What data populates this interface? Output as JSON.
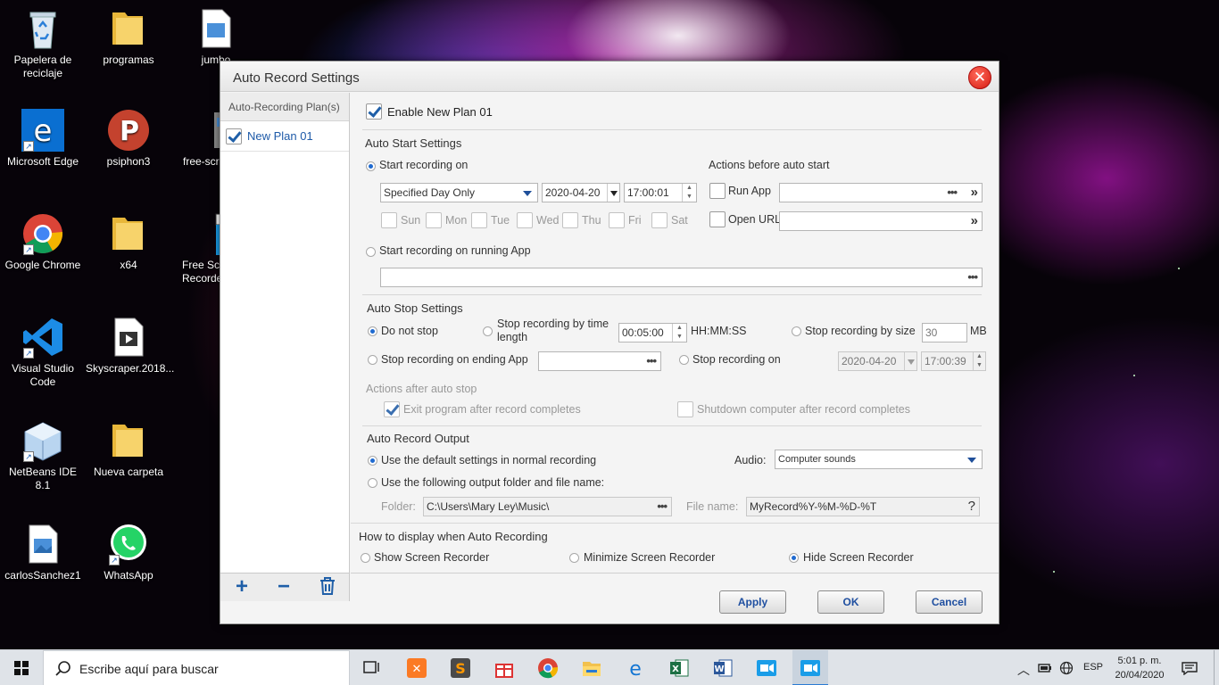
{
  "desktop": {
    "icons": [
      {
        "label": "Papelera de reciclaje",
        "icon": "recycle-bin-icon"
      },
      {
        "label": "programas",
        "icon": "folder-icon"
      },
      {
        "label": "jumbo",
        "icon": "image-file-icon"
      },
      {
        "label": "Microsoft Edge",
        "icon": "edge-icon"
      },
      {
        "label": "psiphon3",
        "icon": "psiphon-icon"
      },
      {
        "label": "free-scree",
        "icon": "app-icon"
      },
      {
        "label": "Google Chrome",
        "icon": "chrome-icon"
      },
      {
        "label": "x64",
        "icon": "folder-icon"
      },
      {
        "label": "Free Sc Recorde",
        "icon": "screen-recorder-icon"
      },
      {
        "label": "Visual Studio Code",
        "icon": "vscode-icon"
      },
      {
        "label": "Skyscraper.2018...",
        "icon": "video-file-icon"
      },
      {
        "label": "NetBeans IDE 8.1",
        "icon": "netbeans-icon"
      },
      {
        "label": "Nueva carpeta",
        "icon": "folder-icon"
      },
      {
        "label": "carlosSanchez1",
        "icon": "image-file-icon"
      },
      {
        "label": "WhatsApp",
        "icon": "whatsapp-icon"
      }
    ]
  },
  "dialog": {
    "title": "Auto Record Settings",
    "plan_list_header": "Auto-Recording Plan(s)",
    "plans": [
      {
        "name": "New Plan 01",
        "checked": true
      }
    ],
    "enable_label": "Enable New Plan 01",
    "auto_start": {
      "heading": "Auto Start Settings",
      "start_on_label": "Start recording on",
      "schedule_mode": "Specified Day Only",
      "date": "2020-04-20",
      "time": "17:00:01",
      "days": [
        "Sun",
        "Mon",
        "Tue",
        "Wed",
        "Thu",
        "Fri",
        "Sat"
      ],
      "running_app_label": "Start recording on running App",
      "actions_heading": "Actions before auto start",
      "run_app_label": "Run App",
      "open_url_label": "Open URL"
    },
    "auto_stop": {
      "heading": "Auto Stop Settings",
      "do_not_stop": "Do not stop",
      "by_time_label": "Stop recording by time length",
      "time_length": "00:05:00",
      "time_unit": "HH:MM:SS",
      "by_size_label": "Stop recording by size",
      "size_value": "30",
      "size_unit": "MB",
      "ending_app_label": "Stop recording on ending App",
      "stop_on_label": "Stop recording on",
      "stop_date": "2020-04-20",
      "stop_time": "17:00:39",
      "actions_after": "Actions after auto stop",
      "exit_program": "Exit program after record completes",
      "shutdown": "Shutdown computer after record completes"
    },
    "output": {
      "heading": "Auto Record Output",
      "default_settings": "Use the default settings in normal recording",
      "custom_output": "Use the following output folder and file name:",
      "audio_label": "Audio:",
      "audio_value": "Computer sounds",
      "folder_label": "Folder:",
      "folder_value": "C:\\Users\\Mary Ley\\Music\\",
      "filename_label": "File name:",
      "filename_value": "MyRecord%Y-%M-%D-%T"
    },
    "display": {
      "heading": "How to display when Auto Recording",
      "show": "Show Screen Recorder",
      "minimize": "Minimize Screen Recorder",
      "hide": "Hide Screen Recorder"
    },
    "buttons": {
      "apply": "Apply",
      "ok": "OK",
      "cancel": "Cancel"
    }
  },
  "taskbar": {
    "search_placeholder": "Escribe aquí para buscar",
    "language": "ESP",
    "time": "5:01 p. m.",
    "date": "20/04/2020"
  }
}
